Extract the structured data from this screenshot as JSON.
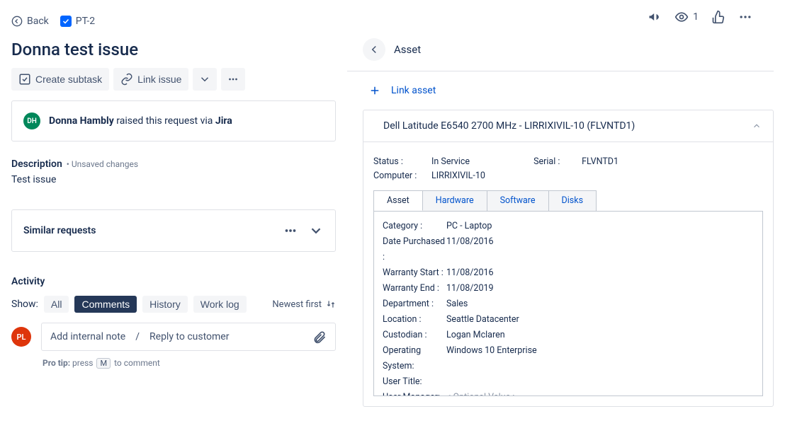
{
  "breadcrumb": {
    "back": "Back",
    "issue_key": "PT-2"
  },
  "top_actions": {
    "watchers": "1"
  },
  "title": "Donna test issue",
  "toolbar": {
    "create_subtask": "Create subtask",
    "link_issue": "Link issue"
  },
  "requester": {
    "initials": "DH",
    "name": "Donna Hambly",
    "mid": " raised this request via ",
    "via": "Jira"
  },
  "description": {
    "label": "Description",
    "unsaved": "• Unsaved changes",
    "text": "Test issue"
  },
  "similar": {
    "label": "Similar requests"
  },
  "activity": {
    "label": "Activity",
    "show": "Show:",
    "filters": {
      "all": "All",
      "comments": "Comments",
      "history": "History",
      "worklog": "Work log"
    },
    "newest": "Newest first"
  },
  "comment": {
    "avatar": "PL",
    "internal": "Add internal note",
    "sep": "/",
    "reply": "Reply to customer",
    "protip_label": "Pro tip:",
    "protip_a": " press ",
    "protip_key": "M",
    "protip_b": " to comment"
  },
  "asset_panel": {
    "head": "Asset",
    "link_asset": "Link asset",
    "title": "Dell Latitude E6540 2700 MHz - LIRRIXIVIL-10 (FLVNTD1)",
    "meta": {
      "status_k": "Status :",
      "status_v": "In Service",
      "serial_k": "Serial :",
      "serial_v": "FLVNTD1",
      "computer_k": "Computer :",
      "computer_v": "LIRRIXIVIL-10"
    },
    "tabs": {
      "asset": "Asset",
      "hardware": "Hardware",
      "software": "Software",
      "disks": "Disks"
    },
    "fields": [
      {
        "k": "Category :",
        "v": "PC - Laptop"
      },
      {
        "k": "Date Purchased :",
        "v": "11/08/2016"
      },
      {
        "k": "Warranty Start :",
        "v": "11/08/2016"
      },
      {
        "k": "Warranty End :",
        "v": "11/08/2019"
      },
      {
        "k": "Department :",
        "v": "Sales"
      },
      {
        "k": "Location :",
        "v": "Seattle Datacenter"
      },
      {
        "k": "Custodian :",
        "v": "Logan Mclaren"
      },
      {
        "k": "Operating System:",
        "v": "Windows 10 Enterprise"
      },
      {
        "k": "User Title:",
        "v": ""
      },
      {
        "k": "User Manager:",
        "v": "< Optional Value >",
        "placeholder": true
      }
    ]
  }
}
